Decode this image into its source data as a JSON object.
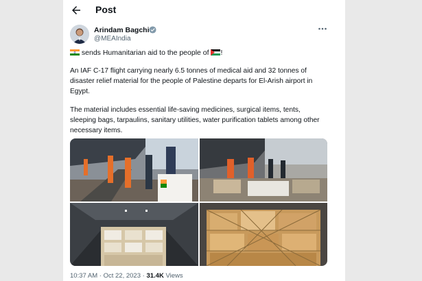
{
  "header": {
    "title": "Post"
  },
  "author": {
    "name": "Arindam Bagchi",
    "handle": "@MEAIndia"
  },
  "tweet": {
    "line1_text": " sends Humanitarian aid to the people of ",
    "line1_end": "!",
    "paragraph1": "An IAF C-17 flight carrying nearly 6.5 tonnes of medical aid and 32 tonnes of disaster relief material for the people of Palestine departs for El-Arish airport in Egypt.",
    "paragraph2": "The material includes essential life-saving medicines, surgical items, tents, sleeping bags, tarpaulins, sanitary utilities, water purification tablets among other necessary items."
  },
  "meta": {
    "time": "10:37 AM",
    "separator": "·",
    "date": "Oct 22, 2023",
    "views_count": "31.4K",
    "views_label": "Views"
  },
  "icons": [
    "back-arrow-icon",
    "verified-badge-icon",
    "more-options-icon",
    "india-flag-icon",
    "palestine-flag-icon"
  ],
  "colors": {
    "text_primary": "#0f1419",
    "text_secondary": "#536471",
    "verified": "#1d9bf0",
    "background": "#ffffff"
  }
}
